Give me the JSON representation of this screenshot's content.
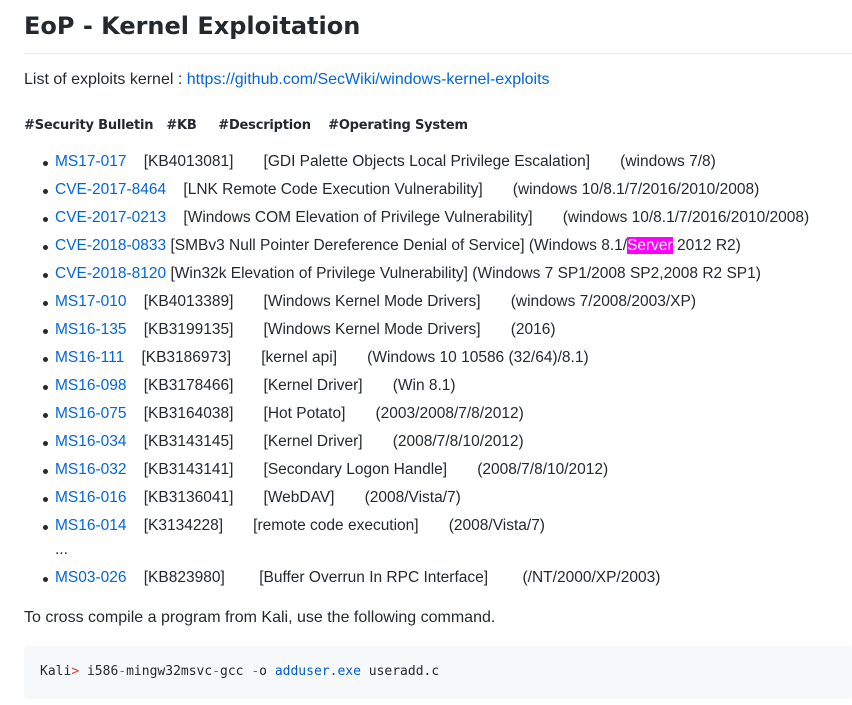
{
  "title": "EoP - Kernel Exploitation",
  "intro": {
    "text": "List of exploits kernel : ",
    "link": "https://github.com/SecWiki/windows-kernel-exploits"
  },
  "columns": [
    "#Security Bulletin",
    "#KB",
    "#Description",
    "#Operating System"
  ],
  "exploits": [
    {
      "id": "MS17-017",
      "rest": "    [KB4013081]       [GDI Palette Objects Local Privilege Escalation]       (windows 7/8)"
    },
    {
      "id": "CVE-2017-8464",
      "rest": "    [LNK Remote Code Execution Vulnerability]       (windows 10/8.1/7/2016/2010/2008)"
    },
    {
      "id": "CVE-2017-0213",
      "rest": "    [Windows COM Elevation of Privilege Vulnerability]       (windows 10/8.1/7/2016/2010/2008)"
    },
    {
      "id": "CVE-2018-0833",
      "rest_before": " [SMBv3 Null Pointer Dereference Denial of Service] (Windows 8.1/",
      "highlight": "Server",
      "rest_after": " 2012 R2)"
    },
    {
      "id": "CVE-2018-8120",
      "rest": " [Win32k Elevation of Privilege Vulnerability] (Windows 7 SP1/2008 SP2,2008 R2 SP1)"
    },
    {
      "id": "MS17-010",
      "rest": "    [KB4013389]       [Windows Kernel Mode Drivers]       (windows 7/2008/2003/XP)"
    },
    {
      "id": "MS16-135",
      "rest": "    [KB3199135]       [Windows Kernel Mode Drivers]       (2016)"
    },
    {
      "id": "MS16-111",
      "rest": "    [KB3186973]       [kernel api]       (Windows 10 10586 (32/64)/8.1)"
    },
    {
      "id": "MS16-098",
      "rest": "    [KB3178466]       [Kernel Driver]       (Win 8.1)"
    },
    {
      "id": "MS16-075",
      "rest": "    [KB3164038]       [Hot Potato]       (2003/2008/7/8/2012)"
    },
    {
      "id": "MS16-034",
      "rest": "    [KB3143145]       [Kernel Driver]       (2008/7/8/10/2012)"
    },
    {
      "id": "MS16-032",
      "rest": "    [KB3143141]       [Secondary Logon Handle]       (2008/7/8/10/2012)"
    },
    {
      "id": "MS16-016",
      "rest": "    [KB3136041]       [WebDAV]       (2008/Vista/7)"
    },
    {
      "id": "MS16-014",
      "rest": "    [K3134228]       [remote code execution]       (2008/Vista/7)"
    }
  ],
  "ellipsis": "...",
  "last_exploit": {
    "id": "MS03-026",
    "rest": "    [KB823980]        [Buffer Overrun In RPC Interface]        (/NT/2000/XP/2003)"
  },
  "cross_compile_text": "To cross compile a program from Kali, use the following command.",
  "code": {
    "prompt": "Kali",
    "gt": ">",
    "cmd1": " i586",
    "dash1": "-",
    "cmd2": "mingw32msvc",
    "dash2": "-",
    "cmd3": "gcc ",
    "dash3": "-",
    "cmd4": "o ",
    "out": "adduser.exe",
    "src": " useradd.c"
  }
}
